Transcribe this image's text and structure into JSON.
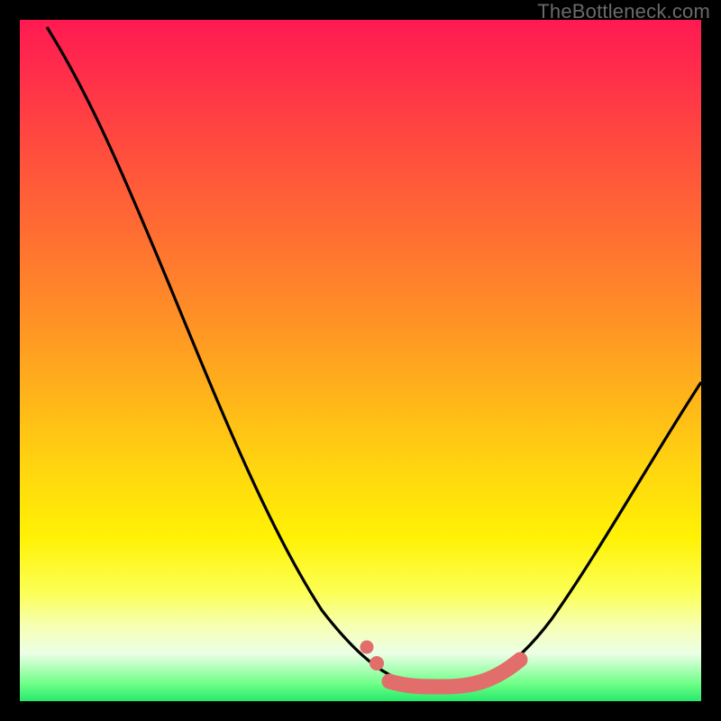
{
  "watermark": "TheBottleneck.com",
  "colors": {
    "curve_stroke": "#000000",
    "highlight": "#e26e6c",
    "background": "#000000"
  },
  "chart_data": {
    "type": "line",
    "title": "",
    "xlabel": "",
    "ylabel": "",
    "xlim": [
      0,
      100
    ],
    "ylim": [
      0,
      100
    ],
    "grid": false,
    "legend": false,
    "series": [
      {
        "name": "bottleneck-curve",
        "x": [
          4,
          10,
          18,
          26,
          34,
          42,
          48,
          52,
          56,
          60,
          64,
          68,
          72,
          78,
          86,
          94,
          100
        ],
        "values": [
          99,
          90,
          77,
          62,
          46,
          29,
          15,
          6,
          2,
          0,
          0,
          0,
          2,
          8,
          22,
          40,
          54
        ]
      }
    ],
    "highlight_segment": {
      "series": "bottleneck-curve",
      "x": [
        52,
        56,
        60,
        64,
        68,
        72
      ],
      "values": [
        6,
        2,
        0,
        0,
        0,
        2
      ]
    },
    "highlight_points": [
      {
        "x": 50,
        "y": 9
      },
      {
        "x": 52,
        "y": 6
      }
    ]
  }
}
